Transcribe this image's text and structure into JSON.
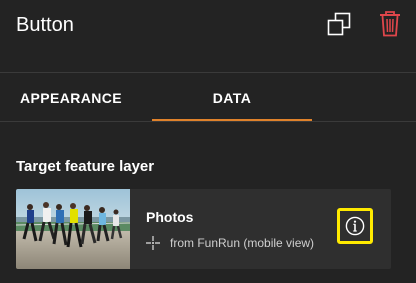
{
  "header": {
    "title": "Button"
  },
  "tabs": [
    {
      "label": "APPEARANCE"
    },
    {
      "label": "DATA"
    }
  ],
  "active_tab": "DATA",
  "section": {
    "title": "Target feature layer"
  },
  "layer_card": {
    "name": "Photos",
    "source": "from FunRun (mobile view)"
  },
  "colors": {
    "background": "#232323",
    "accent_tab_underline": "#e0822b",
    "delete_icon": "#e0464b",
    "highlight_outline": "#ffea00"
  },
  "icons": [
    "duplicate-icon",
    "trash-icon",
    "crosshair-icon",
    "info-icon"
  ]
}
